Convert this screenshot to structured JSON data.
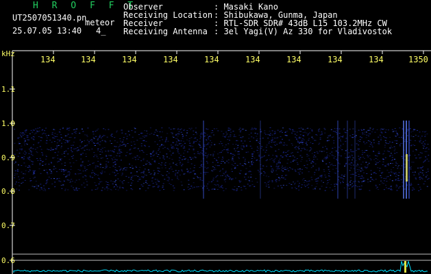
{
  "header": {
    "brand": "H R O F F T",
    "filename": "UT2507051340.pn",
    "file_ext": "meteor",
    "datetime": "25.07.05 13:40",
    "extra": "4_"
  },
  "info": [
    {
      "label": "Observer",
      "value": ": Masaki Kano"
    },
    {
      "label": "Receiving Location",
      "value": ": Shibukawa, Gunma, Japan"
    },
    {
      "label": "Receiver",
      "value": ": RTL-SDR SDR# 43dB L15 103.2MHz CW"
    },
    {
      "label": "Receiving Antenna",
      "value": ": 3el Yagi(V) Az 330 for Vladivostok"
    }
  ],
  "axis": {
    "unit": "kHz",
    "time_ticks": [
      "134",
      "134",
      "134",
      "134",
      "134",
      "134",
      "134",
      "134",
      "134",
      "1350"
    ],
    "freq_ticks": [
      "1.1",
      "1.0",
      "0.9",
      "0.8",
      "0.7",
      "0.6"
    ]
  },
  "colors": {
    "label": "#ffff66",
    "brand": "#22d060",
    "spectrum": "#2a40c0",
    "trace": "#00e0ff"
  }
}
